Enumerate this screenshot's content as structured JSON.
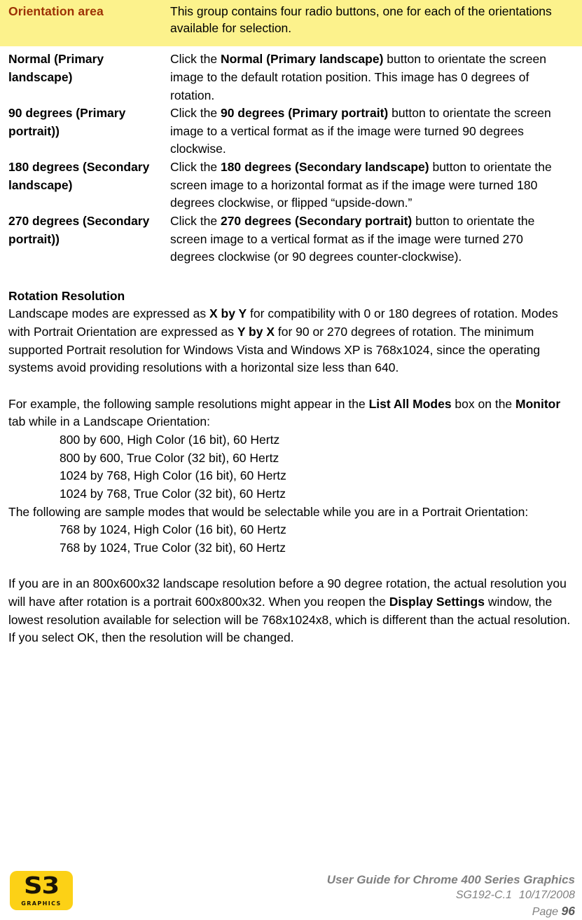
{
  "highlight": {
    "term": "Orientation area",
    "term_color": "#9C3104",
    "background": "#FCF28C",
    "definition": "This group contains four radio buttons, one for each of the orientations available for selection."
  },
  "definitions": [
    {
      "term": "Normal (Primary landscape)",
      "desc_prefix": "Click the ",
      "desc_bold": "Normal (Primary landscape)",
      "desc_suffix": " button to orientate the screen image to the default rotation position. This image has 0 degrees of rotation."
    },
    {
      "term": "90 degrees (Primary portrait))",
      "desc_prefix": "Click the ",
      "desc_bold": "90 degrees (Primary portrait)",
      "desc_suffix": " button to orientate the screen image to a vertical format as if the image were turned 90 degrees clockwise."
    },
    {
      "term": "180 degrees (Secondary landscape)",
      "desc_prefix": "Click the ",
      "desc_bold": "180 degrees (Secondary landscape)",
      "desc_suffix": " button to orientate the screen image to a horizontal format as if the image were turned 180 degrees clockwise, or flipped “upside-down.”"
    },
    {
      "term": "270 degrees (Secondary portrait))",
      "desc_prefix": "Click the ",
      "desc_bold": "270 degrees (Secondary portrait)",
      "desc_suffix": " button to orientate the screen image to a vertical format as if the image were turned 270 degrees clockwise (or 90 degrees counter-clockwise)."
    }
  ],
  "rotation_resolution": {
    "heading": "Rotation Resolution",
    "p1_a": "Landscape modes are expressed as ",
    "p1_b1": "X by Y",
    "p1_c": " for compatibility with 0 or 180 degrees of rotation. Modes with Portrait Orientation are expressed as ",
    "p1_b2": "Y by X",
    "p1_d": " for 90 or 270 degrees of rotation. The minimum supported Portrait resolution for Windows Vista and Windows XP is 768x1024, since the operating systems avoid providing resolutions with a horizontal size less than 640.",
    "p2_a": "For example, the following sample resolutions might appear in the ",
    "p2_b1": "List All Modes",
    "p2_c": " box on the ",
    "p2_b2": "Monitor",
    "p2_d": " tab while in a Landscape Orientation:",
    "landscape_modes": [
      "800 by 600, High Color (16 bit), 60 Hertz",
      "800 by 600, True Color (32 bit), 60 Hertz",
      "1024 by 768, High Color (16 bit), 60 Hertz",
      "1024 by 768, True Color (32 bit), 60 Hertz"
    ],
    "p3": "The following are sample modes that would be selectable while you are in a Portrait Orientation:",
    "portrait_modes": [
      "768 by 1024, High Color (16 bit), 60 Hertz",
      "768 by 1024, True Color (32 bit), 60 Hertz"
    ],
    "p4_a": "If you are in an 800x600x32 landscape resolution before a 90 degree rotation, the actual resolution you will have after rotation is a portrait 600x800x32. When you reopen the ",
    "p4_b": "Display Settings",
    "p4_c": " window, the lowest resolution available for selection will be 768x1024x8, which is different than the actual resolution. If you select OK, then the resolution will be changed."
  },
  "footer": {
    "logo_brand": "S3",
    "logo_sub": "GRAPHICS",
    "logo_bg": "#FCD116",
    "title": "User Guide for Chrome 400 Series Graphics",
    "revision": "SG192-C.1",
    "date": "10/17/2008",
    "page_label": "Page",
    "page_number": "96"
  }
}
